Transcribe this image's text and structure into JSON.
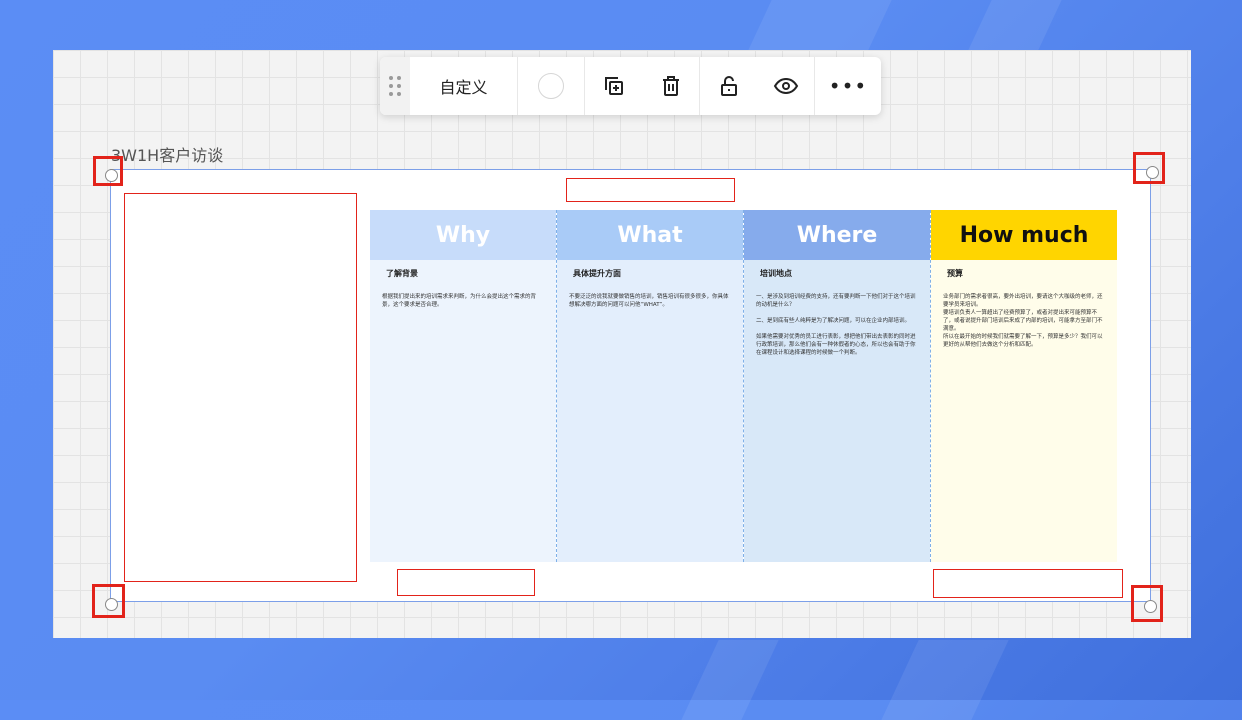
{
  "toolbar": {
    "label": "自定义",
    "more": "•••",
    "icons": [
      "drag-handle-icon",
      "color-swatch",
      "duplicate-icon",
      "delete-icon",
      "unlock-icon",
      "eye-icon",
      "more-icon"
    ]
  },
  "board": {
    "title": "3W1H客户访谈"
  },
  "columns": [
    {
      "heading": "Why",
      "subtitle": "了解背景",
      "text": "根据我们提出来的培训需求来判断，为什么会提出这个需求的背景，这个要求是否合理。",
      "head_color": "#c7dcfa",
      "body_color": "#edf4fd",
      "head_text_color": "#ffffff"
    },
    {
      "heading": "What",
      "subtitle": "具体提升方面",
      "text": "不要泛泛的说我就要做销售的培训，销售培训有很多很多，你具体想解决哪方面的问题可以问他“WHAT”。",
      "head_color": "#a9cbf7",
      "body_color": "#e3eefc",
      "head_text_color": "#ffffff"
    },
    {
      "heading": "Where",
      "subtitle": "培训地点",
      "text": "一、是涉及到培训经费的支持，还有要判断一下他们对于这个培训的动机是什么？\n\n二、是到底有些人纯粹是为了解决问题，可以在企业内部培训。\n\n如果他需要对优秀的员工进行表彰，想把他们带出去表彰的同时进行政策培训，那么他们会有一种休假者的心态，所以也会有助于你在课程设计和选择课程的时候做一个判断。",
      "head_color": "#86abec",
      "body_color": "#d8e8f8",
      "head_text_color": "#ffffff"
    },
    {
      "heading": "How much",
      "subtitle": "预算",
      "text": "业务部门的需求者很高，要外出培训，要请这个大咖级的老师，还要学员来培训。\n要培训负责人一算超出了经费预算了，或者对提出来可能预算不了，或者说提升部门培训后来成了内部的培训，可能拿方至部门不满意。\n所以在最开始的时候我们就需要了解一下，预算是多少？我们可以更好的从帮他们去做这个分析和匹配。",
      "head_color": "#ffd500",
      "body_color": "#fffdea",
      "head_text_color": "#111111"
    }
  ]
}
